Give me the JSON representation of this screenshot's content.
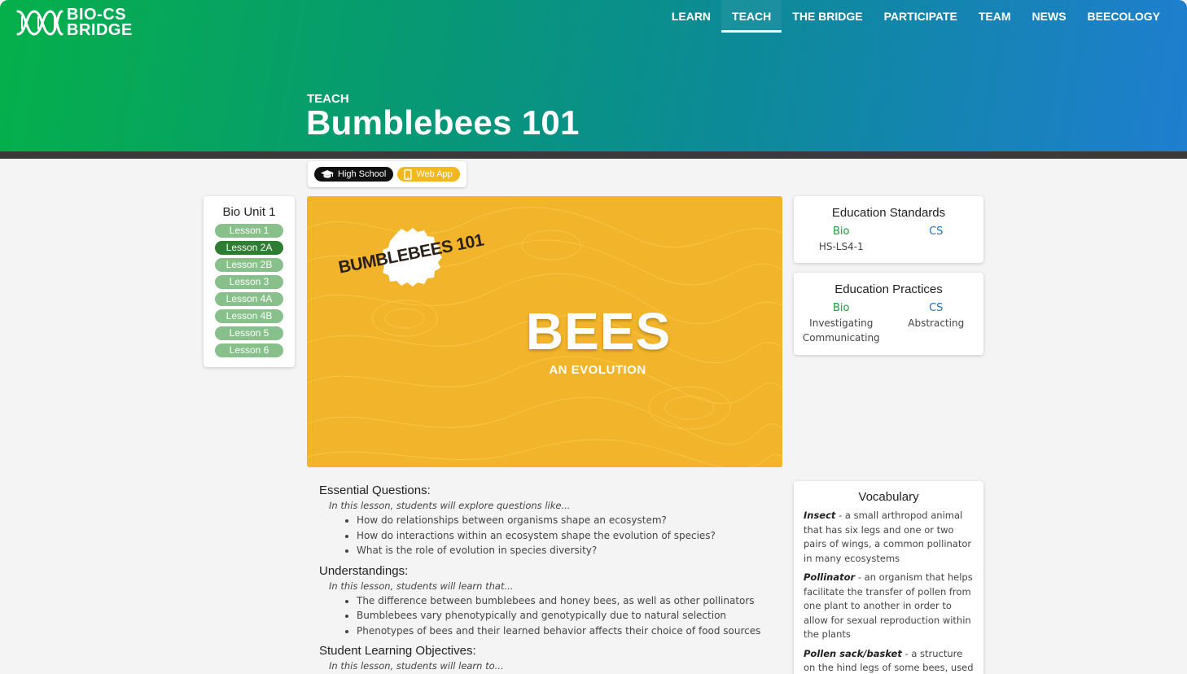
{
  "logo": {
    "line1": "BIO-CS",
    "line2": "BRIDGE"
  },
  "nav": [
    {
      "label": "LEARN",
      "active": false
    },
    {
      "label": "TEACH",
      "active": true
    },
    {
      "label": "THE BRIDGE",
      "active": false
    },
    {
      "label": "PARTICIPATE",
      "active": false
    },
    {
      "label": "TEAM",
      "active": false
    },
    {
      "label": "NEWS",
      "active": false
    },
    {
      "label": "BEECOLOGY",
      "active": false
    }
  ],
  "header": {
    "section": "TEACH",
    "title": "Bumblebees 101"
  },
  "tags": {
    "level": "High School",
    "format": "Web App"
  },
  "unit": {
    "title": "Bio Unit 1",
    "lessons": [
      "Lesson 1",
      "Lesson 2A",
      "Lesson 2B",
      "Lesson 3",
      "Lesson 4A",
      "Lesson 4B",
      "Lesson 5",
      "Lesson 6"
    ],
    "active": "Lesson 2A"
  },
  "banner": {
    "badge": "BUMBLEBEES 101",
    "title": "BEES",
    "subtitle": "AN EVOLUTION"
  },
  "standards": {
    "title": "Education Standards",
    "bio_label": "Bio",
    "bio_items": [
      "HS-LS4-1"
    ],
    "cs_label": "CS",
    "cs_items": []
  },
  "practices": {
    "title": "Education Practices",
    "bio_label": "Bio",
    "bio_items": [
      "Investigating",
      "Communicating"
    ],
    "cs_label": "CS",
    "cs_items": [
      "Abstracting"
    ]
  },
  "vocabulary": {
    "title": "Vocabulary",
    "terms": [
      {
        "term": "Insect",
        "definition": " - a small arthropod animal that has six legs and one or two pairs of wings, a common pollinator in many ecosystems"
      },
      {
        "term": "Pollinator",
        "definition": " - an organism that helps facilitate the transfer of pollen from one plant to another in order to allow for sexual reproduction within the plants"
      },
      {
        "term": "Pollen sack/basket",
        "definition": " - a structure on the hind legs of some bees, used for harvesting and carrying pollen from"
      }
    ]
  },
  "essential": {
    "heading": "Essential Questions:",
    "intro": "In this lesson, students will explore questions like...",
    "items": [
      "How do relationships between organisms shape an ecosystem?",
      "How do interactions within an ecosystem shape the evolution of species?",
      "What is the role of evolution in species diversity?"
    ]
  },
  "understandings": {
    "heading": "Understandings:",
    "intro": "In this lesson, students will learn that...",
    "items": [
      "The difference between bumblebees and honey bees, as well as other pollinators",
      "Bumblebees vary phenotypically and genotypically due to natural selection",
      "Phenotypes of bees and their learned behavior affects their choice of food sources"
    ]
  },
  "objectives": {
    "heading": "Student Learning Objectives:",
    "intro": "In this lesson, students will learn to..."
  }
}
